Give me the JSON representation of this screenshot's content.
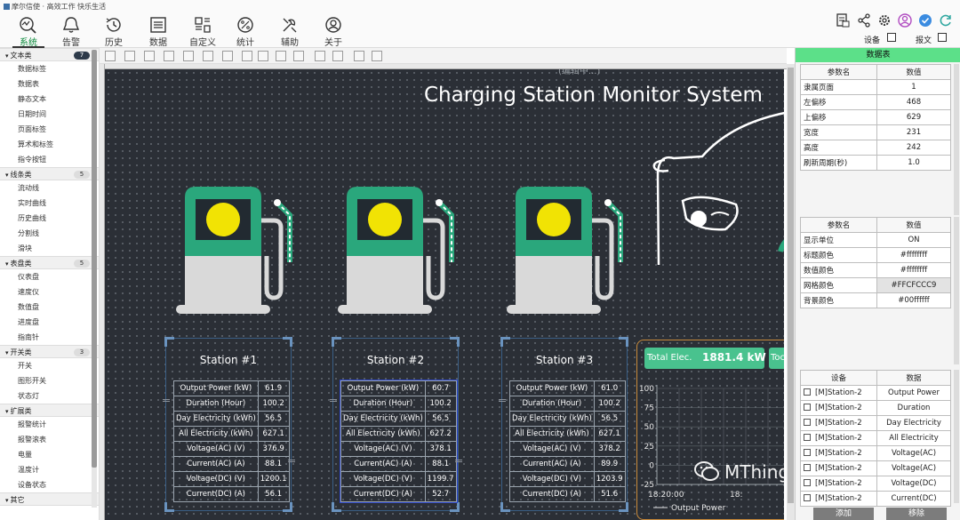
{
  "brand": "摩尔信使 · 高效工作 快乐生活",
  "nav": [
    {
      "label": "系统",
      "icon": "system-search-icon",
      "active": true
    },
    {
      "label": "告警",
      "icon": "bell-icon"
    },
    {
      "label": "历史",
      "icon": "history-clock-icon"
    },
    {
      "label": "数据",
      "icon": "data-list-icon"
    },
    {
      "label": "自定义",
      "icon": "custom-layout-icon"
    },
    {
      "label": "统计",
      "icon": "percent-icon"
    },
    {
      "label": "辅助",
      "icon": "assist-tools-icon"
    },
    {
      "label": "关于",
      "icon": "user-about-icon"
    }
  ],
  "top_right": {
    "device_label": "设备",
    "message_label": "报文"
  },
  "left_panel": {
    "categories": [
      {
        "name": "文本类",
        "count": "7",
        "items": [
          "数据标签",
          "数据表",
          "静态文本",
          "日期时间",
          "页面标签",
          "算术和标签",
          "指令按钮"
        ]
      },
      {
        "name": "线条类",
        "count": "5",
        "items": [
          "流动线",
          "实时曲线",
          "历史曲线",
          "分割线",
          "滑块"
        ]
      },
      {
        "name": "表盘类",
        "count": "5",
        "items": [
          "仪表盘",
          "速度仪",
          "数值盘",
          "进度盘",
          "指南针"
        ]
      },
      {
        "name": "开关类",
        "count": "3",
        "items": [
          "开关",
          "图形开关",
          "状态灯"
        ]
      },
      {
        "name": "扩展类",
        "count": "",
        "items": [
          "报警统计",
          "报警滚表",
          "电量",
          "温度计",
          "设备状态"
        ]
      },
      {
        "name": "其它",
        "count": "",
        "items": []
      }
    ]
  },
  "canvas": {
    "editing_label": "(编辑中...)",
    "title": "Charging Station Monitor System",
    "stations": [
      {
        "name": "Station #1",
        "rows": [
          [
            "Output Power (kW)",
            "61.9"
          ],
          [
            "Duration (Hour)",
            "100.2"
          ],
          [
            "Day Electricity (kWh)",
            "56.5"
          ],
          [
            "All Electricity (kWh)",
            "627.1"
          ],
          [
            "Voltage(AC) (V)",
            "376.9"
          ],
          [
            "Current(AC) (A)",
            "88.1"
          ],
          [
            "Voltage(DC) (V)",
            "1200.1"
          ],
          [
            "Current(DC) (A)",
            "56.1"
          ]
        ]
      },
      {
        "name": "Station #2",
        "rows": [
          [
            "Output Power (kW)",
            "60.7"
          ],
          [
            "Duration (Hour)",
            "100.2"
          ],
          [
            "Day Electricity (kWh)",
            "56.5"
          ],
          [
            "All Electricity (kWh)",
            "627.2"
          ],
          [
            "Voltage(AC) (V)",
            "378.1"
          ],
          [
            "Current(AC) (A)",
            "88.1"
          ],
          [
            "Voltage(DC) (V)",
            "1199.7"
          ],
          [
            "Current(DC) (A)",
            "52.7"
          ]
        ]
      },
      {
        "name": "Station #3",
        "rows": [
          [
            "Output Power (kW)",
            "61.0"
          ],
          [
            "Duration (Hour)",
            "100.2"
          ],
          [
            "Day Electricity (kWh)",
            "56.5"
          ],
          [
            "All Electricity (kWh)",
            "627.1"
          ],
          [
            "Voltage(AC) (V)",
            "378.2"
          ],
          [
            "Current(AC) (A)",
            "89.9"
          ],
          [
            "Voltage(DC) (V)",
            "1203.9"
          ],
          [
            "Current(DC) (A)",
            "51.6"
          ]
        ]
      }
    ],
    "total_label": "Total Elec.",
    "total_value": "1881.4 kW",
    "today_label": "Toc",
    "watermark": "MThings技术服务"
  },
  "chart_data": {
    "type": "line",
    "title": "",
    "xlabel": "",
    "ylabel": "",
    "y_ticks": [
      "100",
      "75",
      "50",
      "25",
      "0",
      "-25"
    ],
    "x_ticks": [
      "18:20:00",
      "18:"
    ],
    "ylim": [
      -25,
      100
    ],
    "grid": true,
    "legend": "bottom",
    "series": [
      {
        "name": "Output Power",
        "values": []
      }
    ]
  },
  "right_panel": {
    "header": "数据表",
    "table1": {
      "headers": [
        "参数名",
        "数值"
      ],
      "rows": [
        [
          "隶属页面",
          "1"
        ],
        [
          "左偏移",
          "468"
        ],
        [
          "上偏移",
          "629"
        ],
        [
          "宽度",
          "231"
        ],
        [
          "高度",
          "242"
        ],
        [
          "刷新周期(秒)",
          "1.0"
        ]
      ]
    },
    "table2": {
      "headers": [
        "参数名",
        "数值"
      ],
      "rows": [
        [
          "显示单位",
          "ON"
        ],
        [
          "标题颜色",
          "#ffffffff"
        ],
        [
          "数值颜色",
          "#ffffffff"
        ],
        [
          "网格颜色",
          "#FFCFCCC9"
        ],
        [
          "背景颜色",
          "#00ffffff"
        ]
      ]
    },
    "table3": {
      "headers": [
        "设备",
        "数据"
      ],
      "rows": [
        [
          "[M]Station-2",
          "Output Power"
        ],
        [
          "[M]Station-2",
          "Duration"
        ],
        [
          "[M]Station-2",
          "Day Electricity"
        ],
        [
          "[M]Station-2",
          "All Electricity"
        ],
        [
          "[M]Station-2",
          "Voltage(AC)"
        ],
        [
          "[M]Station-2",
          "Voltage(AC)"
        ],
        [
          "[M]Station-2",
          "Voltage(DC)"
        ],
        [
          "[M]Station-2",
          "Current(DC)"
        ]
      ]
    },
    "add_button": "添加",
    "remove_button": "移除"
  },
  "colors": {
    "accent_green": "#49c28e",
    "panel_header": "#5ce089",
    "canvas_bg": "#2b2f36",
    "pump_green": "#2aa77c",
    "pump_yellow": "#f1e304",
    "chart_border": "#c98a3a"
  }
}
